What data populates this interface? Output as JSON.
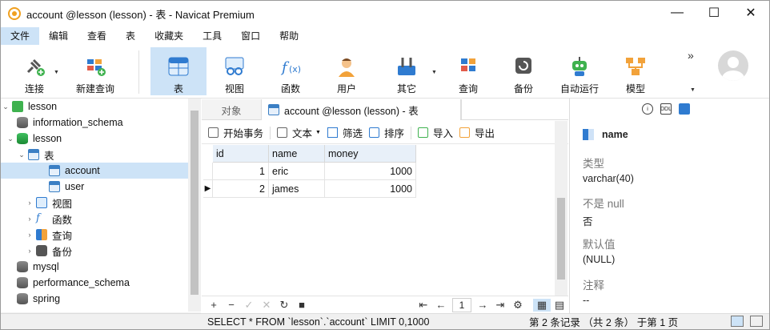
{
  "window": {
    "title": "account @lesson (lesson) - 表 - Navicat Premium",
    "minimize": "—",
    "maximize": "☐",
    "close": "✕"
  },
  "menu": [
    "文件",
    "编辑",
    "查看",
    "表",
    "收藏夹",
    "工具",
    "窗口",
    "帮助"
  ],
  "toolbar": {
    "connect": "连接",
    "new_query": "新建查询",
    "table": "表",
    "view": "视图",
    "function": "函数",
    "user": "用户",
    "other": "其它",
    "query": "查询",
    "backup": "备份",
    "automation": "自动运行",
    "model": "模型",
    "more": "»"
  },
  "tree": {
    "lesson_root": "lesson",
    "information_schema": "information_schema",
    "lesson_db": "lesson",
    "tables": "表",
    "account": "account",
    "user": "user",
    "views": "视图",
    "functions": "函数",
    "queries": "查询",
    "backups": "备份",
    "mysql": "mysql",
    "performance_schema": "performance_schema",
    "spring": "spring"
  },
  "tabs": {
    "objects": "对象",
    "active": "account @lesson (lesson) - 表"
  },
  "subtoolbar": {
    "begin_transaction": "开始事务",
    "text": "文本",
    "filter": "筛选",
    "sort": "排序",
    "import": "导入",
    "export": "导出"
  },
  "grid": {
    "columns": [
      "id",
      "name",
      "money"
    ],
    "rows": [
      {
        "id": "1",
        "name": "eric",
        "money": "1000"
      },
      {
        "id": "2",
        "name": "james",
        "money": "1000"
      }
    ]
  },
  "nav": {
    "page": "1"
  },
  "status": {
    "sql": "SELECT * FROM `lesson`.`account` LIMIT 0,1000",
    "records": "第 2 条记录 （共 2 条） 于第 1 页"
  },
  "panel": {
    "field_name": "name",
    "type_label": "类型",
    "type_value": "varchar(40)",
    "notnull_label": "不是 null",
    "notnull_value": "否",
    "default_label": "默认值",
    "default_value": "(NULL)",
    "comment_label": "注释",
    "comment_value": "--"
  }
}
